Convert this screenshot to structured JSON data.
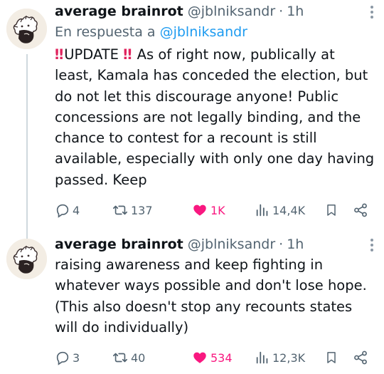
{
  "tweets": [
    {
      "display_name": "average brainrot",
      "handle": "@jblniksandr",
      "separator": "·",
      "time": "1h",
      "reply_prefix": "En respuesta a",
      "reply_mention": "@jblniksandr",
      "alert_emoji_left": "‼",
      "alert_emoji_right": "‼",
      "update_label": "UPDATE",
      "body_rest": " As of right now, publically at least, Kamala has conceded the election, but do not let this discourage anyone! Public concessions are not legally binding, and the chance to contest for a recount is still available, especially with only one day having passed. Keep",
      "replies": "4",
      "retweets": "137",
      "likes": "1K",
      "views": "14,4K",
      "liked": true
    },
    {
      "display_name": "average brainrot",
      "handle": "@jblniksandr",
      "separator": "·",
      "time": "1h",
      "body": "raising awareness and keep fighting in whatever ways possible and don't lose hope. (This also doesn't stop any recounts states will do individually)",
      "replies": "3",
      "retweets": "40",
      "likes": "534",
      "views": "12,3K",
      "liked": true
    }
  ],
  "colors": {
    "text": "#0f1419",
    "muted": "#536471",
    "link": "#1d9bf0",
    "like": "#f91880",
    "thread_line": "#cfd9de"
  },
  "icons": [
    "reply-icon",
    "retweet-icon",
    "heart-icon",
    "views-icon",
    "bookmark-icon",
    "share-icon",
    "more-icon"
  ]
}
